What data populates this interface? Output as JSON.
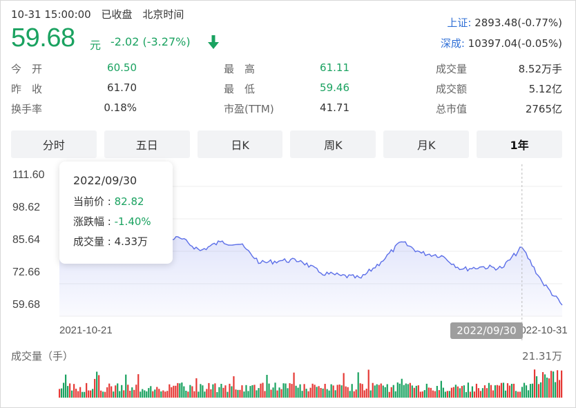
{
  "header": {
    "datetime": "10-31 15:00:00",
    "status": "已收盘",
    "timezone": "北京时间",
    "price": "59.68",
    "unit": "元",
    "change": "-2.02 (-3.27%)"
  },
  "indices": [
    {
      "name": "上证:",
      "value": "2893.48(-0.77%)"
    },
    {
      "name": "深成:",
      "value": "10397.04(-0.05%)"
    }
  ],
  "stats": {
    "open_label": "今　开",
    "open": "60.50",
    "prev_label": "昨　收",
    "prev": "61.70",
    "turnover_label": "换手率",
    "turnover": "0.18%",
    "high_label": "最　高",
    "high": "61.11",
    "low_label": "最　低",
    "low": "59.46",
    "pe_label": "市盈(TTM)",
    "pe": "41.71",
    "volume_label": "成交量",
    "volume": "8.52万手",
    "amount_label": "成交额",
    "amount": "5.12亿",
    "mktcap_label": "总市值",
    "mktcap": "2765亿"
  },
  "tabs": [
    "分时",
    "五日",
    "日K",
    "周K",
    "月K",
    "1年"
  ],
  "active_tab": "1年",
  "chart": {
    "y_ticks": [
      "111.60",
      "98.62",
      "85.64",
      "72.66",
      "59.68"
    ],
    "x_start": "2021-10-21",
    "x_end": "2022-10-31",
    "cursor_date": "2022/09/30",
    "line_color": "#5b6ee8",
    "up_color": "#e53935",
    "down_color": "#1aa260"
  },
  "tooltip": {
    "date": "2022/09/30",
    "price_label": "当前价 : ",
    "price": "82.82",
    "change_label": "涨跌幅 : ",
    "change": "-1.40%",
    "volume_label": "成交量 : ",
    "volume": "4.33万"
  },
  "volume": {
    "title": "成交量（手）",
    "max": "21.31万"
  },
  "chart_data": {
    "type": "line",
    "title": "",
    "xlabel": "",
    "ylabel": "",
    "ylim": [
      59.68,
      111.6
    ],
    "x": [
      "2021-10-21",
      "2021-11-08",
      "2021-11-22",
      "2021-12-06",
      "2021-12-20",
      "2022-01-04",
      "2022-01-18",
      "2022-02-08",
      "2022-02-22",
      "2022-03-08",
      "2022-03-22",
      "2022-04-06",
      "2022-04-20",
      "2022-05-06",
      "2022-05-20",
      "2022-06-06",
      "2022-06-20",
      "2022-07-04",
      "2022-07-18",
      "2022-08-01",
      "2022-08-15",
      "2022-08-29",
      "2022-09-13",
      "2022-09-30",
      "2022-10-14",
      "2022-10-31"
    ],
    "series": [
      {
        "values": [
          89.5,
          92.0,
          90.5,
          95.0,
          90.0,
          86.0,
          86.5,
          81.5,
          85.0,
          84.0,
          76.5,
          77.5,
          77.5,
          72.5,
          71.5,
          70.5,
          77.0,
          85.0,
          80.5,
          79.5,
          74.0,
          75.0,
          74.5,
          82.8,
          69.0,
          59.7
        ]
      }
    ]
  }
}
